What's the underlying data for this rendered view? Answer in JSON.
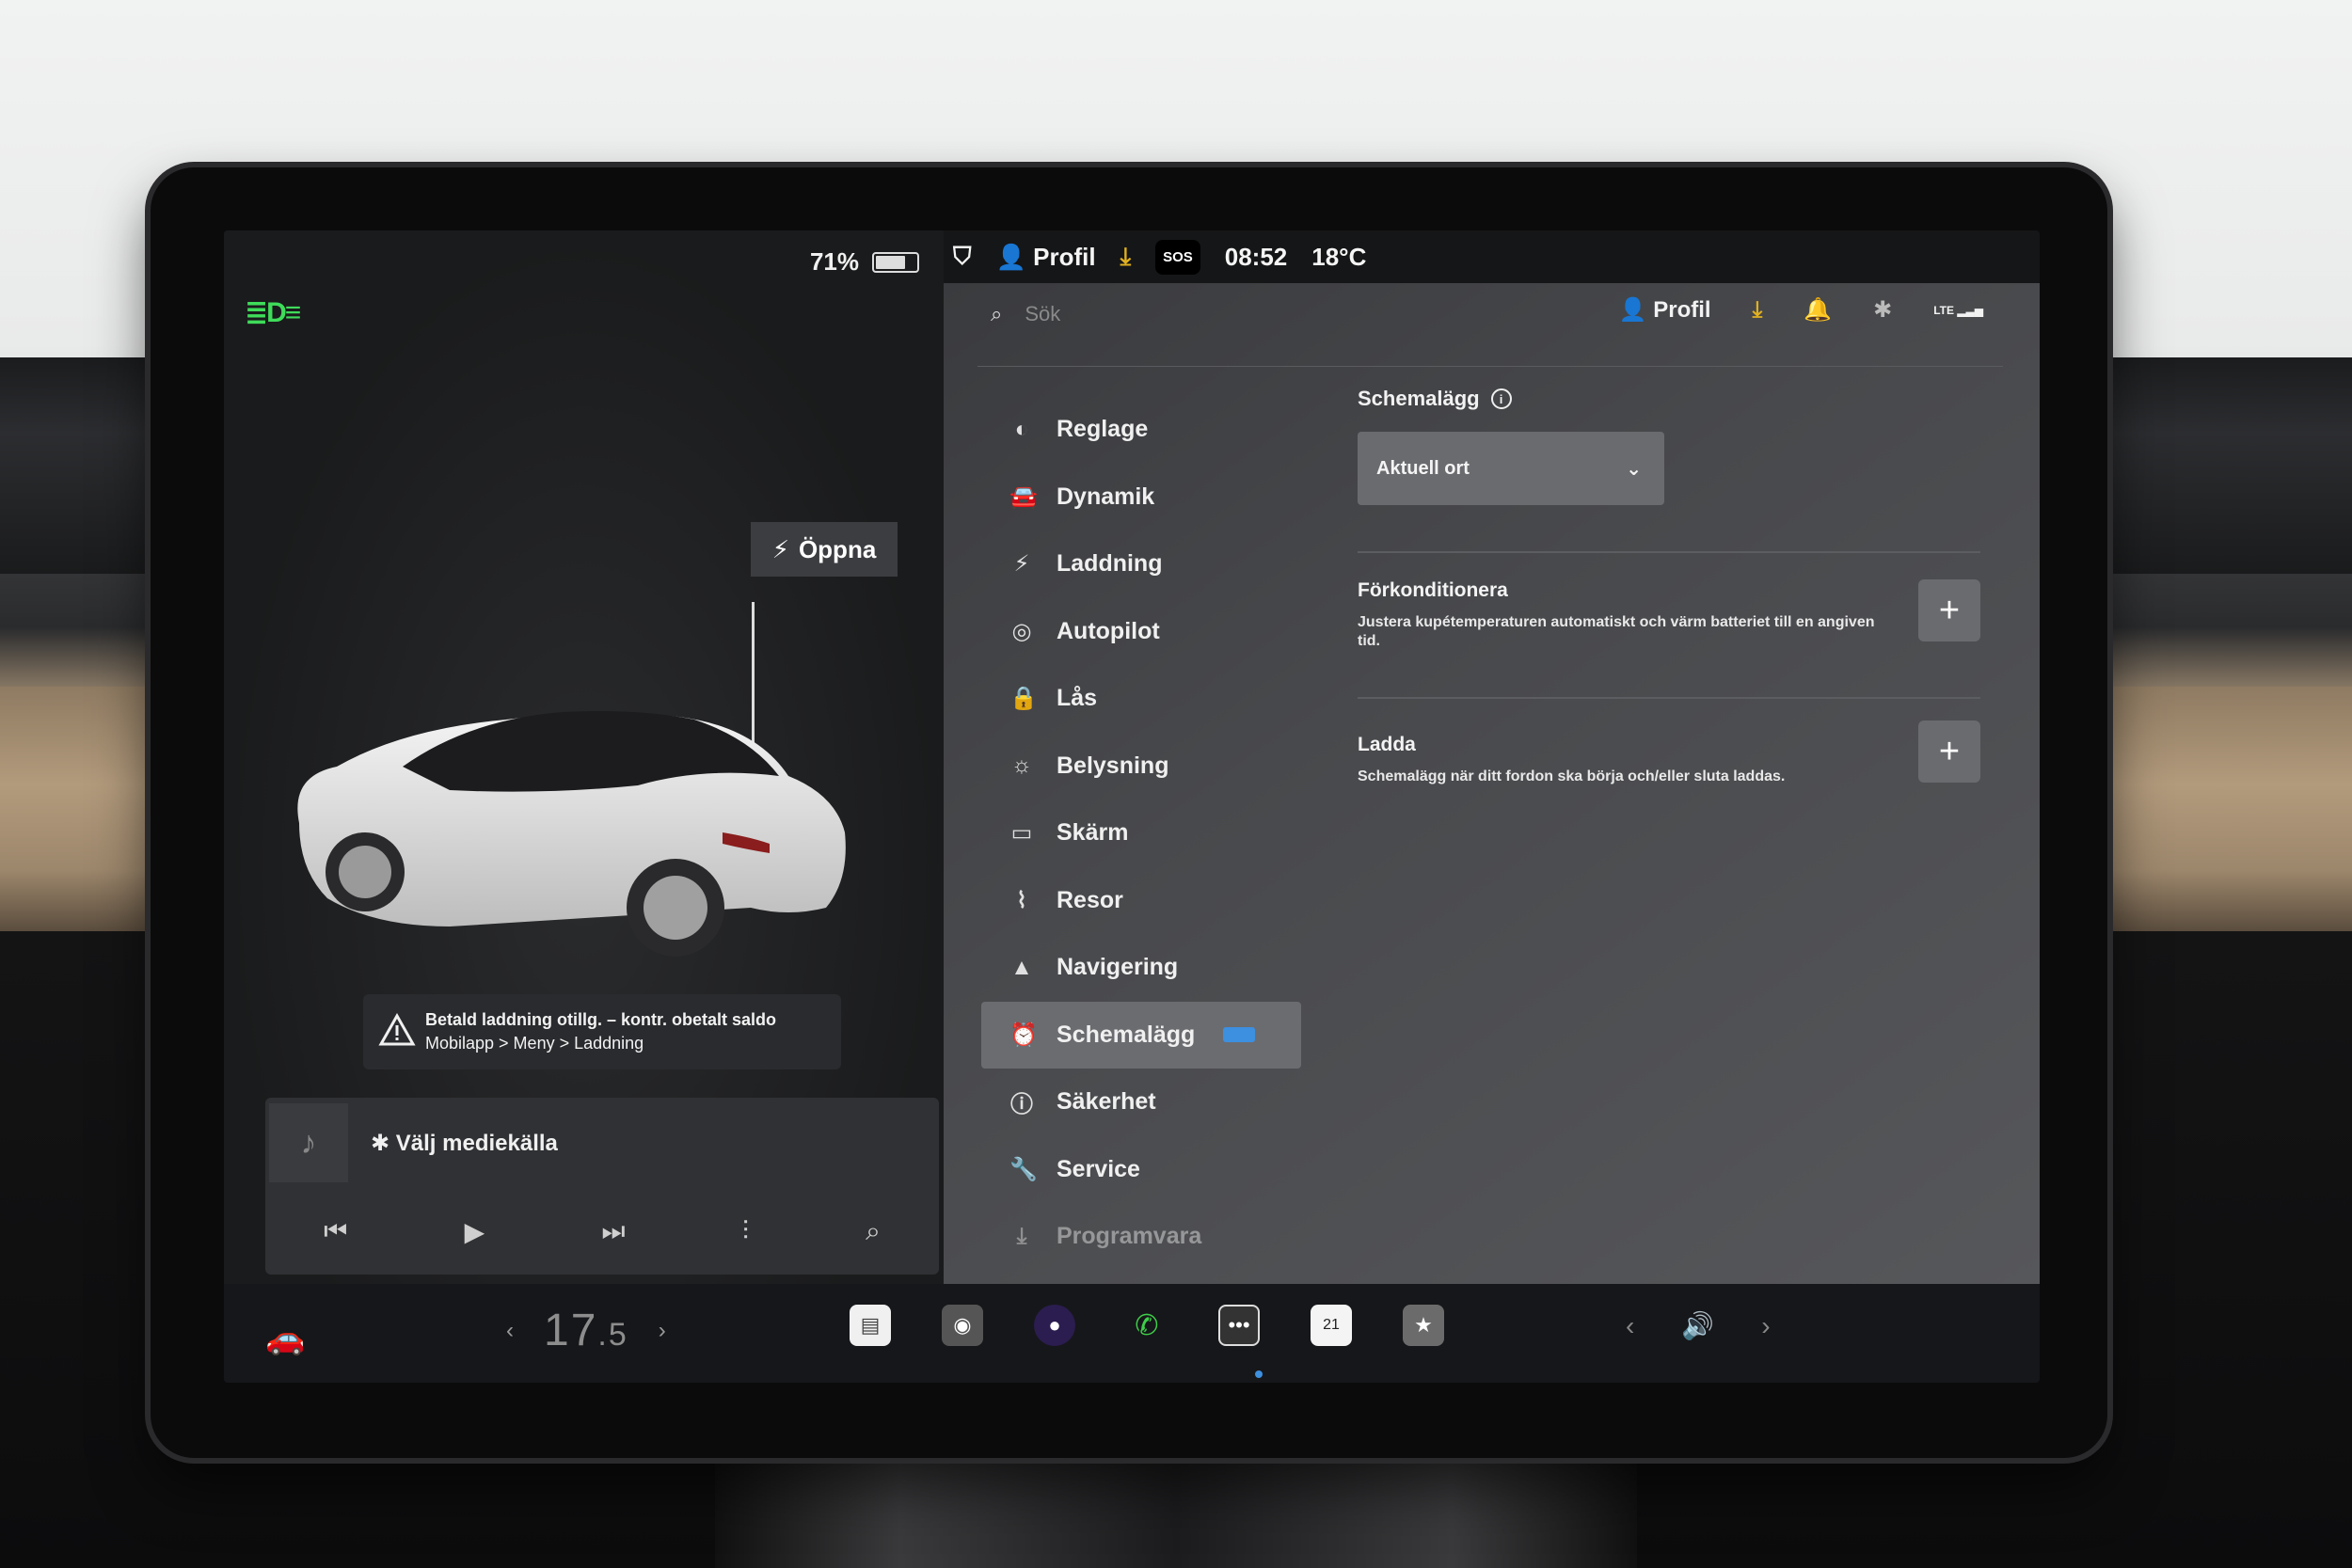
{
  "battery": {
    "percent": "71%",
    "level": 0.71
  },
  "status": {
    "profile": "Profil",
    "sos": "SOS",
    "time": "08:52",
    "temp": "18°C"
  },
  "car": {
    "open_label": "Öppna"
  },
  "warning": {
    "title": "Betald laddning otillg. – kontr. obetalt saldo",
    "path": "Mobilapp > Meny > Laddning"
  },
  "media": {
    "title": "Välj mediekälla"
  },
  "search": {
    "placeholder": "Sök"
  },
  "header": {
    "profile": "Profil",
    "lte": "LTE"
  },
  "menu": {
    "items": [
      {
        "label": "Reglage",
        "icon": "toggle-icon"
      },
      {
        "label": "Dynamik",
        "icon": "car-icon"
      },
      {
        "label": "Laddning",
        "icon": "bolt-icon"
      },
      {
        "label": "Autopilot",
        "icon": "steering-wheel-icon"
      },
      {
        "label": "Lås",
        "icon": "lock-icon"
      },
      {
        "label": "Belysning",
        "icon": "sun-icon"
      },
      {
        "label": "Skärm",
        "icon": "display-icon"
      },
      {
        "label": "Resor",
        "icon": "trips-icon"
      },
      {
        "label": "Navigering",
        "icon": "navigation-icon"
      },
      {
        "label": "Schemalägg",
        "icon": "alarm-clock-icon",
        "active": true
      },
      {
        "label": "Säkerhet",
        "icon": "safety-icon"
      },
      {
        "label": "Service",
        "icon": "wrench-icon"
      },
      {
        "label": "Programvara",
        "icon": "download-icon"
      }
    ]
  },
  "schedule": {
    "title": "Schemalägg",
    "location": "Aktuell ort",
    "precondition": {
      "title": "Förkonditionera",
      "desc": "Justera kupétemperaturen automatiskt och värm batteriet till en angiven tid."
    },
    "charge": {
      "title": "Ladda",
      "desc": "Schemalägg när ditt fordon ska börja och/eller sluta laddas."
    }
  },
  "dock": {
    "temp_main": "17",
    "temp_decimal": ".5",
    "calendar_day": "21"
  },
  "colors": {
    "accent": "#3d8fe0",
    "headlight": "#3fdc5a",
    "download": "#e0b020"
  }
}
